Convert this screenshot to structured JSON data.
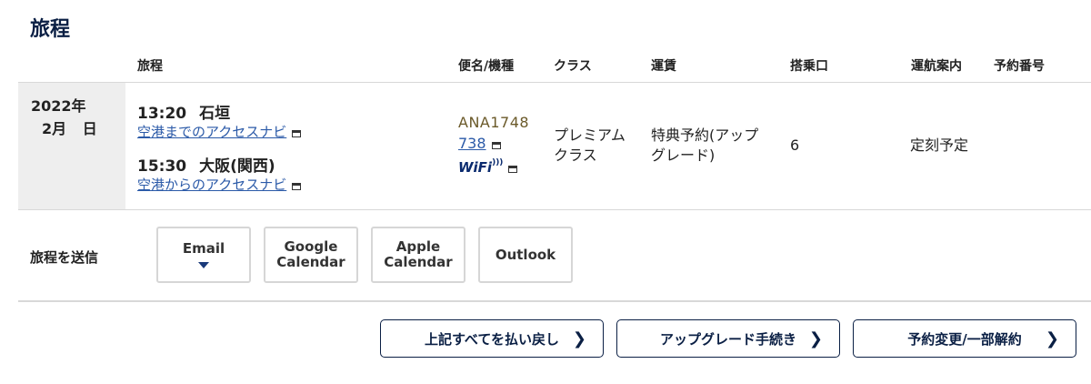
{
  "page": {
    "title": "旅程"
  },
  "headers": {
    "itinerary": "旅程",
    "flight": "便名/機種",
    "class": "クラス",
    "fare": "運賃",
    "gate": "搭乗口",
    "status": "運航案内",
    "booking": "予約番号"
  },
  "trip": {
    "date_year": "2022年",
    "date_md": "2月 日",
    "departure": {
      "time": "13:20",
      "place": "石垣",
      "link": "空港までのアクセスナビ"
    },
    "arrival": {
      "time": "15:30",
      "place": "大阪(関西)",
      "link": "空港からのアクセスナビ"
    },
    "flight_no": "ANA1748",
    "aircraft": "738",
    "wifi": "WiFi",
    "class_line1": "プレミアム",
    "class_line2": "クラス",
    "fare_line1": "特典予約(アップ",
    "fare_line2": "グレード)",
    "gate": "6",
    "status": "定刻予定",
    "booking": ""
  },
  "share": {
    "label": "旅程を送信",
    "buttons": [
      {
        "line1": "Email",
        "line2": ""
      },
      {
        "line1": "Google",
        "line2": "Calendar"
      },
      {
        "line1": "Apple",
        "line2": "Calendar"
      },
      {
        "line1": "Outlook",
        "line2": ""
      }
    ]
  },
  "actions": [
    {
      "label": "上記すべてを払い戻し"
    },
    {
      "label": "アップグレード手続き"
    },
    {
      "label": "予約変更/一部解約"
    }
  ],
  "colors": {
    "navy": "#0a1f44",
    "link": "#2b5aa8",
    "flight_no": "#6b5a2a"
  },
  "icons": {
    "external": "window-icon",
    "chevron": "chevron-right-icon",
    "caret": "caret-down-icon"
  }
}
